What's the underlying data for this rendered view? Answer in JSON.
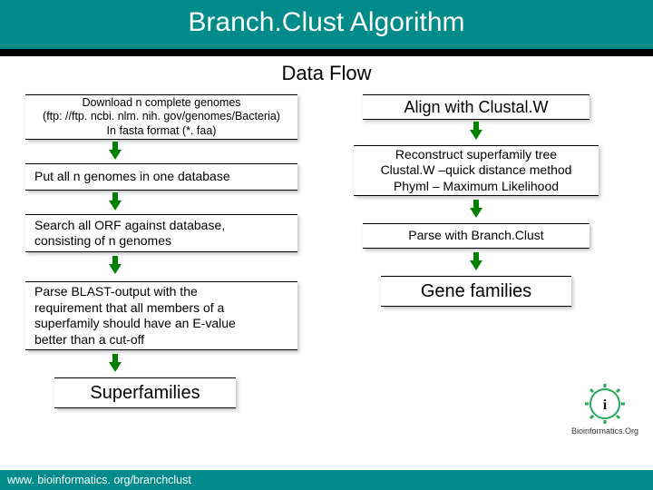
{
  "title": "Branch.Clust Algorithm",
  "subtitle": "Data Flow",
  "left": {
    "download": {
      "l1": "Download n complete genomes",
      "l2": "(ftp: //ftp. ncbi. nlm. nih. gov/genomes/Bacteria)",
      "l3": "In fasta format (*. faa)"
    },
    "putall": "Put all n genomes in one database",
    "search": {
      "l1": "Search all ORF against database,",
      "l2": "consisting of n genomes"
    },
    "parse": {
      "l1": "Parse BLAST-output with the",
      "l2": "requirement that all members of a",
      "l3": "superfamily should have an E-value",
      "l4": "better than a cut-off"
    },
    "result": "Superfamilies"
  },
  "right": {
    "align": "Align with Clustal.W",
    "reconstruct": {
      "l1": "Reconstruct superfamily tree",
      "l2": "Clustal.W –quick distance method",
      "l3": "Phyml – Maximum Likelihood"
    },
    "parsebc": "Parse with Branch.Clust",
    "result": "Gene families"
  },
  "footer": "www. bioinformatics. org/branchclust",
  "logo_label": "Bioinformatics.Org"
}
